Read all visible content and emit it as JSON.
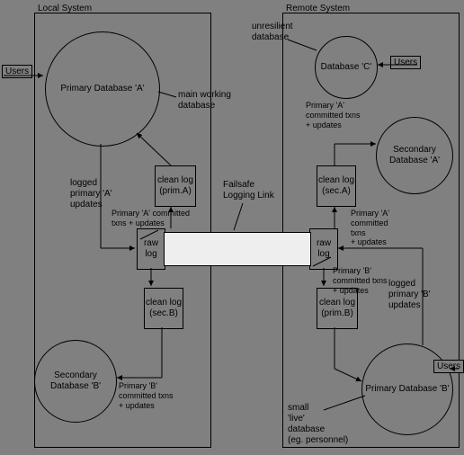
{
  "local_title": "Local System",
  "remote_title": "Remote System",
  "users": "Users",
  "primary_a": "Primary\nDatabase\n'A'",
  "primary_b": "Primary\nDatabase\n'B'",
  "secondary_a": "Secondary\nDatabase\n'A'",
  "secondary_b": "Secondary\nDatabase\n'B'",
  "database_c": "Database\n'C'",
  "raw_log": "raw\nlog",
  "clean_log_prim_a": "clean\nlog\n(prim.A)",
  "clean_log_sec_b": "clean\nlog\n(sec.B)",
  "clean_log_sec_a": "clean\nlog\n(sec.A)",
  "clean_log_prim_b": "clean\nlog\n(prim.B)",
  "main_working": "main working\ndatabase",
  "unresilient": "unresilient\ndatabase",
  "small_live": "small\n'live'\ndatabase\n(eg. personnel)",
  "failsafe": "Failsafe\nLogging Link",
  "logged_a": "logged\nprimary 'A'\nupdates",
  "logged_b": "logged\nprimary 'B'\nupdates",
  "prim_a_committed": "Primary 'A' committed\ntxns + updates",
  "prim_b_committed": "Primary 'B'\ncommitted txns\n+ updates",
  "prim_a_committed2": "Primary 'A'\ncommitted txns\n+ updates",
  "prim_a_committed3": "Primary 'A'\ncommitted\ntxns\n+ updates",
  "prim_b_committed2": "Primary 'B'\ncommitted txns\n+ updates"
}
